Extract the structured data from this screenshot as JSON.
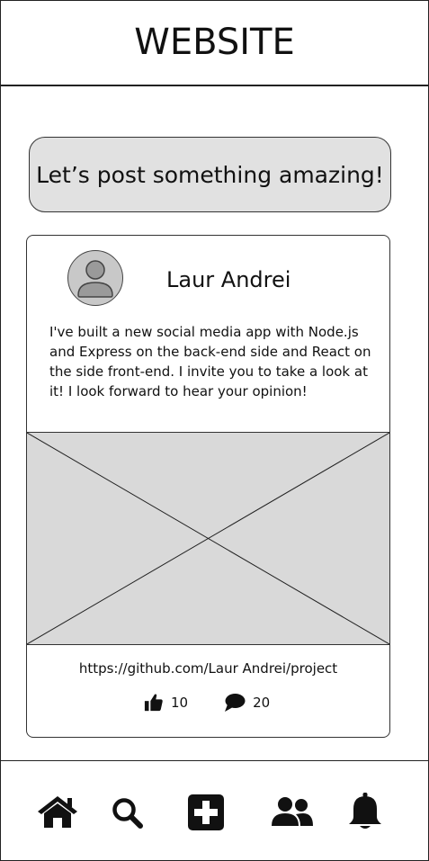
{
  "header": {
    "title": "WEBSITE"
  },
  "compose": {
    "label": "Let’s post something amazing!"
  },
  "post": {
    "author": "Laur Andrei",
    "text": "I've built a new social media app with Node.js and Express on the back-end side and React on the side front-end. I invite you to take a look at it! I look forward to hear your opinion!",
    "link": "https://github.com/Laur Andrei/project",
    "likes": "10",
    "comments": "20"
  },
  "icons": {
    "avatar": "user-avatar-icon",
    "image": "image-placeholder",
    "like": "thumbs-up-icon",
    "comment": "comment-icon",
    "nav": [
      "home-icon",
      "search-icon",
      "add-post-icon",
      "friends-icon",
      "bell-icon"
    ]
  },
  "colors": {
    "compose_bg": "#e1e1e1",
    "image_bg": "#d9d9d9",
    "avatar_bg": "#c8c8c8",
    "icon": "#111111"
  }
}
